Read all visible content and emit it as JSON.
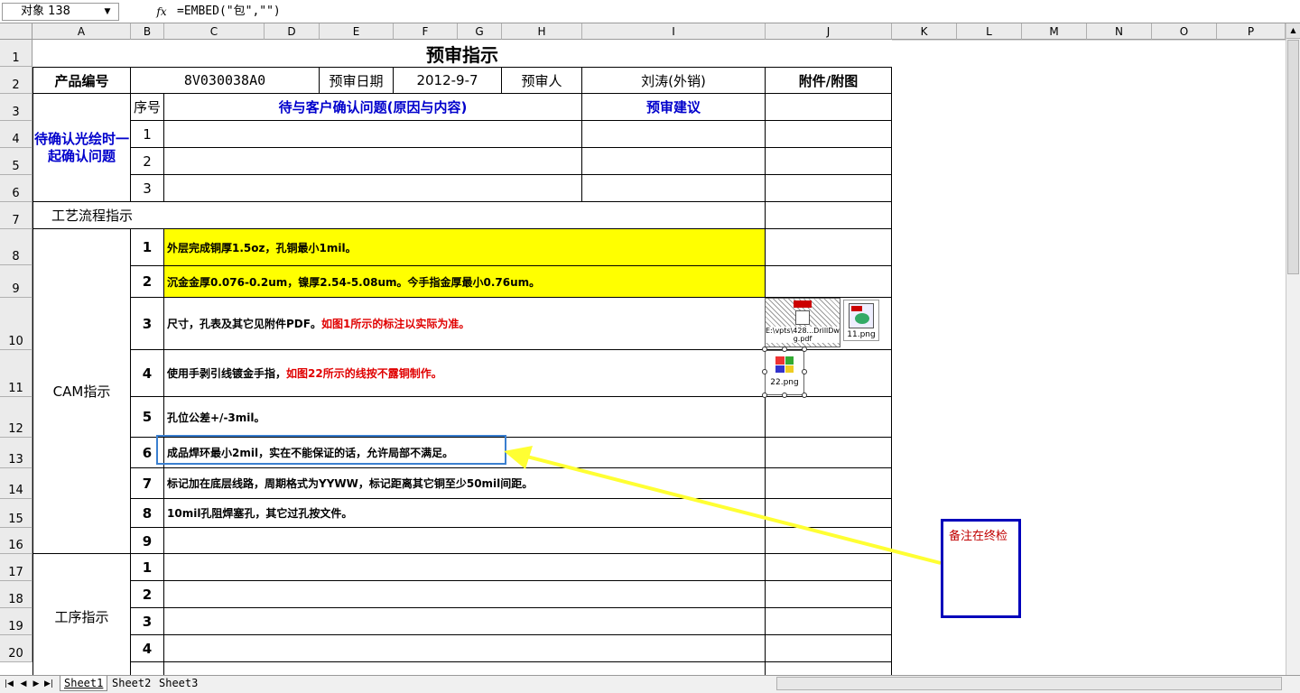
{
  "formula_bar": {
    "name_box": "对象 138",
    "fx": "fx",
    "formula": "=EMBED(\"包\",\"\")"
  },
  "columns": [
    "A",
    "B",
    "C",
    "D",
    "E",
    "F",
    "G",
    "H",
    "I",
    "J",
    "K",
    "L",
    "M",
    "N",
    "O",
    "P"
  ],
  "rows": [
    "1",
    "2",
    "3",
    "4",
    "5",
    "6",
    "7",
    "8",
    "9",
    "10",
    "11",
    "12",
    "13",
    "14",
    "15",
    "16",
    "17",
    "18",
    "19",
    "20"
  ],
  "sheet": {
    "title": "预审指示",
    "product_label": "产品编号",
    "product_value": "8V030038A0",
    "review_date_label": "预审日期",
    "review_date_value": "2012-9-7",
    "reviewer_label": "预审人",
    "reviewer_value": "刘涛(外销)",
    "attach_label": "附件/附图",
    "section_pending": "待确认光绘时一起确认问题",
    "seq_label": "序号",
    "question_label": "待与客户确认问题(原因与内容)",
    "advice_label": "预审建议",
    "pending_nums": [
      "1",
      "2",
      "3"
    ],
    "process_label": "工艺流程指示",
    "cam_label": "CAM指示",
    "cam_nums": [
      "1",
      "2",
      "3",
      "4",
      "5",
      "6",
      "7",
      "8",
      "9"
    ],
    "cam_items": [
      {
        "text": "外层完成铜厚1.5oz，孔铜最小1mil。",
        "red": ""
      },
      {
        "text": "沉金金厚0.076-0.2um，镍厚2.54-5.08um。今手指金厚最小0.76um。",
        "red": ""
      },
      {
        "text": "尺寸，孔表及其它见附件PDF。",
        "red": "如图1所示的标注以实际为准。"
      },
      {
        "text": "使用手剥引线镀金手指，",
        "red": "如图22所示的线按不露铜制作。"
      },
      {
        "text": "孔位公差+/-3mil。",
        "red": ""
      },
      {
        "text": "成品焊环最小2mil，实在不能保证的话，允许局部不满足。",
        "red": ""
      },
      {
        "text": "标记加在底层线路，周期格式为YYWW，标记距离其它铜至少50mil间距。",
        "red": ""
      },
      {
        "text": "10mil孔阻焊塞孔，其它过孔按文件。",
        "red": ""
      },
      {
        "text": "",
        "red": ""
      }
    ],
    "process_step_label": "工序指示",
    "process_nums": [
      "1",
      "2",
      "3",
      "4"
    ]
  },
  "objects": {
    "pdf_label": "E:\\vpts\\428...DrillDwg.pdf",
    "img11_label": "11.png",
    "img22_label": "22.png"
  },
  "note": {
    "text": "备注在终检"
  },
  "tabs": [
    "Sheet1",
    "Sheet2",
    "Sheet3"
  ],
  "colors": {
    "title_blue": "#0000cc",
    "highlight": "#ffff00",
    "arrow": "#ffff33",
    "note_border": "#0000bb"
  }
}
